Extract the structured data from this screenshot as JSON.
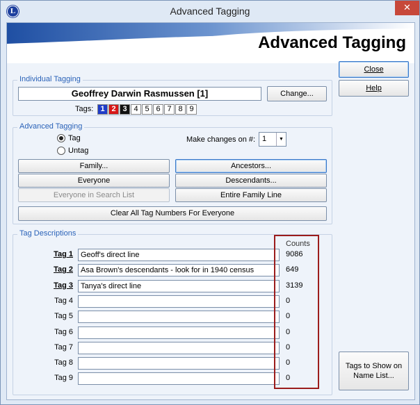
{
  "window": {
    "title": "Advanced Tagging",
    "app_icon_letter": "L",
    "close_glyph": "✕"
  },
  "banner": {
    "title": "Advanced Tagging"
  },
  "buttons": {
    "close": "Close",
    "help": "Help",
    "tags_to_show_line1": "Tags to Show on",
    "tags_to_show_line2": "Name List..."
  },
  "individual": {
    "legend": "Individual Tagging",
    "person_name": "Geoffrey Darwin Rasmussen [1]",
    "change_button": "Change...",
    "tags_label": "Tags:",
    "tags": [
      {
        "num": "1",
        "bg": "#1f3cc8",
        "fg": "#ffffff"
      },
      {
        "num": "2",
        "bg": "#d81818",
        "fg": "#ffffff"
      },
      {
        "num": "3",
        "bg": "#111111",
        "fg": "#ffffff"
      },
      {
        "num": "4",
        "bg": "#ffffff",
        "fg": "#000000"
      },
      {
        "num": "5",
        "bg": "#ffffff",
        "fg": "#000000"
      },
      {
        "num": "6",
        "bg": "#ffffff",
        "fg": "#000000"
      },
      {
        "num": "7",
        "bg": "#ffffff",
        "fg": "#000000"
      },
      {
        "num": "8",
        "bg": "#ffffff",
        "fg": "#000000"
      },
      {
        "num": "9",
        "bg": "#ffffff",
        "fg": "#000000"
      }
    ]
  },
  "advanced": {
    "legend": "Advanced Tagging",
    "radio_tag": "Tag",
    "radio_untag": "Untag",
    "make_changes_label": "Make changes on #:",
    "make_changes_value": "1",
    "family": "Family...",
    "ancestors": "Ancestors...",
    "everyone": "Everyone",
    "descendants": "Descendants...",
    "everyone_search": "Everyone in Search List",
    "entire_family": "Entire Family Line",
    "clear_all": "Clear All Tag Numbers For Everyone"
  },
  "descriptions": {
    "legend": "Tag Descriptions",
    "counts_header": "Counts",
    "rows": [
      {
        "label": "Tag 1",
        "text": "Geoff's direct line",
        "count": "9086"
      },
      {
        "label": "Tag 2",
        "text": "Asa Brown's descendants - look for in 1940 census",
        "count": "649"
      },
      {
        "label": "Tag 3",
        "text": "Tanya's direct line",
        "count": "3139"
      },
      {
        "label": "Tag 4",
        "text": "",
        "count": "0"
      },
      {
        "label": "Tag 5",
        "text": "",
        "count": "0"
      },
      {
        "label": "Tag 6",
        "text": "",
        "count": "0"
      },
      {
        "label": "Tag 7",
        "text": "",
        "count": "0"
      },
      {
        "label": "Tag 8",
        "text": "",
        "count": "0"
      },
      {
        "label": "Tag 9",
        "text": "",
        "count": "0"
      }
    ]
  },
  "colors": {
    "accent_blue": "#2a62b8",
    "highlight_border": "#9b1c1c",
    "close_button": "#c7483a"
  }
}
